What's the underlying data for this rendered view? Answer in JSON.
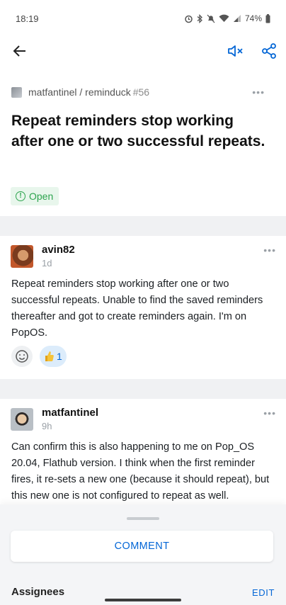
{
  "status_bar": {
    "time": "18:19",
    "battery": "74%"
  },
  "repo": {
    "owner_repo": "matfantinel / reminduck",
    "number": "#56"
  },
  "issue": {
    "title": "Repeat reminders stop working after one or two successful repeats.",
    "state": "Open"
  },
  "comments": [
    {
      "author": "avin82",
      "time": "1d",
      "body": "Repeat reminders stop working after one or two successful repeats. Unable to find the saved reminders thereafter and got to create reminders again. I'm on PopOS.",
      "reaction_count": "1"
    },
    {
      "author": "matfantinel",
      "time": "9h",
      "body": "Can confirm this is also happening to me on Pop_OS 20.04, Flathub version. I think when the first reminder fires, it re-sets a new one (because it should repeat), but this new one is not configured to repeat as well."
    }
  ],
  "sheet": {
    "comment_button": "COMMENT",
    "assignees_label": "Assignees",
    "edit_label": "EDIT"
  },
  "icons": {
    "back": "arrow-left-icon",
    "mute": "volume-mute-icon",
    "share": "share-icon",
    "add_reaction": "smiley-icon",
    "thumbs_up": "thumbs-up-icon",
    "more": "more-horizontal-icon"
  },
  "colors": {
    "accent": "#0366d6",
    "open_green": "#2da44e"
  }
}
